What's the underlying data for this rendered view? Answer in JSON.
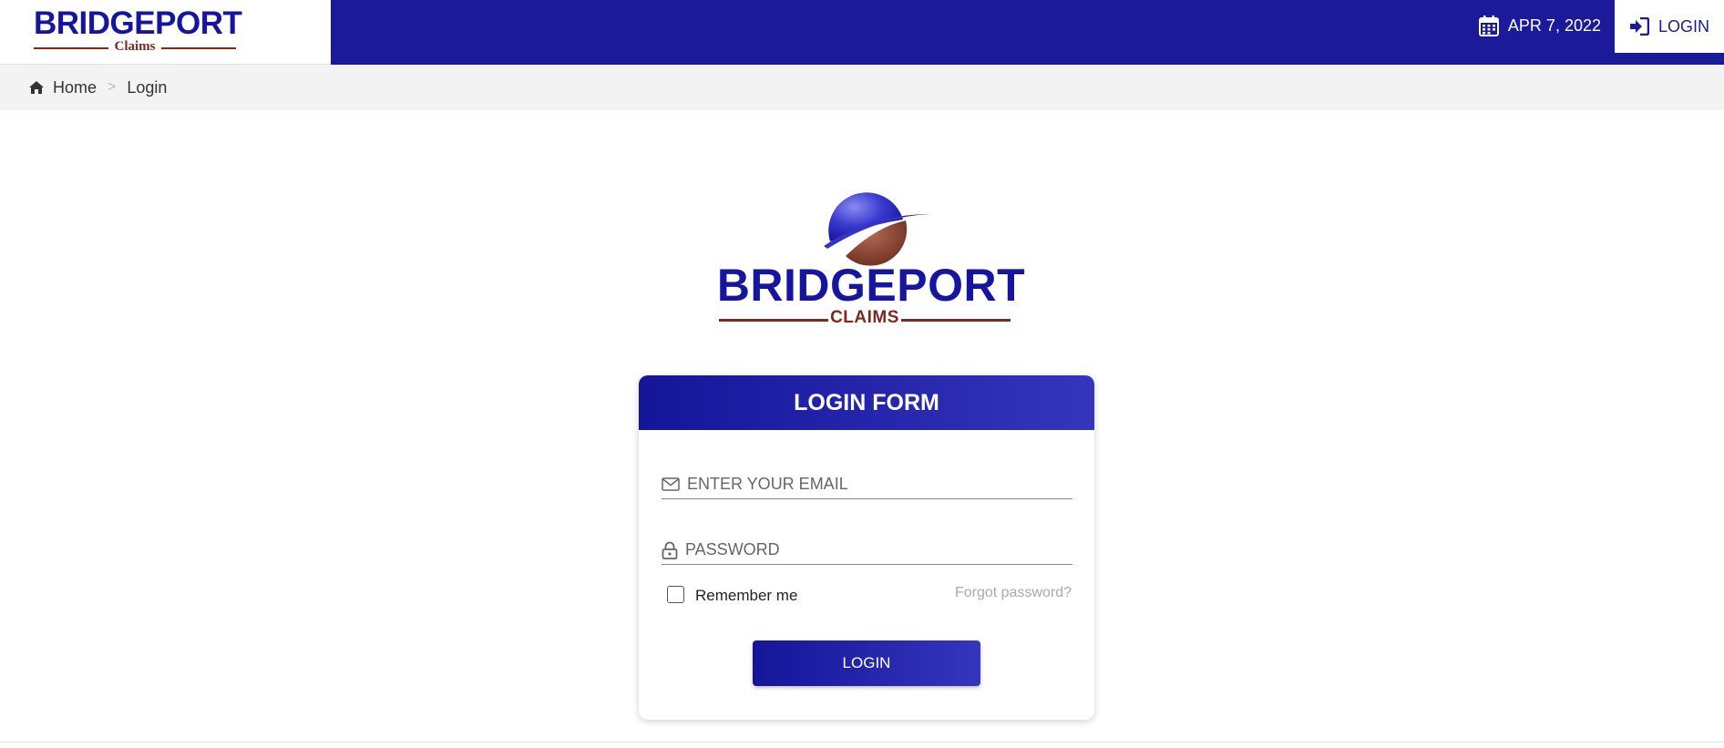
{
  "header": {
    "brand_name": "BRIDGEPORT",
    "brand_sub": "Claims",
    "date": "APR 7, 2022",
    "login_label": "LOGIN",
    "colors": {
      "primary": "#1a1a9a",
      "brand_red": "#7a2a1e"
    },
    "icons": {
      "date": "calendar-icon",
      "login": "sign-in-icon"
    }
  },
  "breadcrumb": {
    "items": [
      "Home",
      "Login"
    ],
    "separator": ">"
  },
  "hero": {
    "logo_name": "BRIDGEPORT",
    "logo_sub": "CLAIMS"
  },
  "login_form": {
    "title": "LOGIN FORM",
    "email_placeholder": "ENTER YOUR EMAIL",
    "password_placeholder": "PASSWORD",
    "remember_label": "Remember me",
    "remember_checked": false,
    "forgot_label": "Forgot password?",
    "submit_label": "LOGIN",
    "icons": {
      "email": "envelope-icon",
      "password": "lock-icon"
    }
  }
}
